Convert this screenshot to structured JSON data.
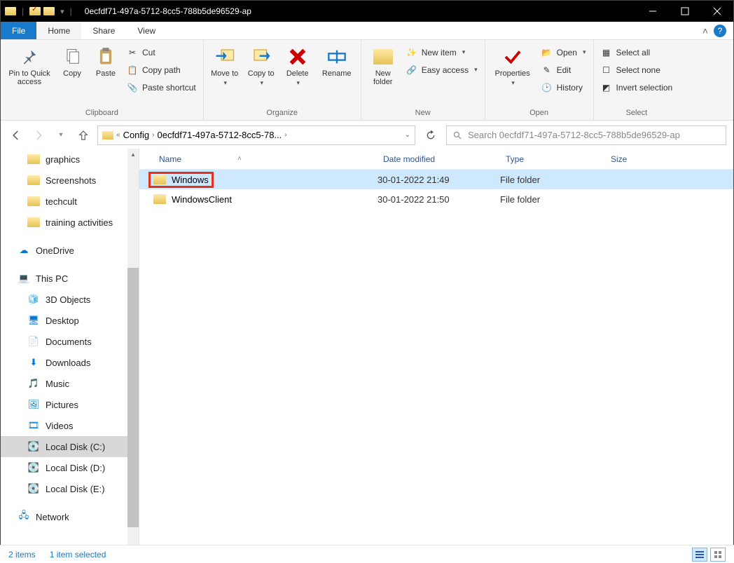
{
  "title": "0ecfdf71-497a-5712-8cc5-788b5de96529-ap",
  "tabs": {
    "file": "File",
    "home": "Home",
    "share": "Share",
    "view": "View"
  },
  "ribbon": {
    "clipboard": {
      "label": "Clipboard",
      "pin": "Pin to Quick access",
      "copy": "Copy",
      "paste": "Paste",
      "cut": "Cut",
      "copypath": "Copy path",
      "pasteshortcut": "Paste shortcut"
    },
    "organize": {
      "label": "Organize",
      "moveto": "Move to",
      "copyto": "Copy to",
      "delete": "Delete",
      "rename": "Rename"
    },
    "new": {
      "label": "New",
      "newfolder": "New folder",
      "newitem": "New item",
      "easyaccess": "Easy access"
    },
    "open": {
      "label": "Open",
      "properties": "Properties",
      "open": "Open",
      "edit": "Edit",
      "history": "History"
    },
    "select": {
      "label": "Select",
      "all": "Select all",
      "none": "Select none",
      "invert": "Invert selection"
    }
  },
  "breadcrumb": {
    "seg1": "Config",
    "seg2": "0ecfdf71-497a-5712-8cc5-78..."
  },
  "search_placeholder": "Search 0ecfdf71-497a-5712-8cc5-788b5de96529-ap",
  "tree": {
    "graphics": "graphics",
    "screenshots": "Screenshots",
    "techcult": "techcult",
    "training": "training activities",
    "onedrive": "OneDrive",
    "thispc": "This PC",
    "objects3d": "3D Objects",
    "desktop": "Desktop",
    "documents": "Documents",
    "downloads": "Downloads",
    "music": "Music",
    "pictures": "Pictures",
    "videos": "Videos",
    "diskc": "Local Disk (C:)",
    "diskd": "Local Disk (D:)",
    "diske": "Local Disk (E:)",
    "network": "Network"
  },
  "columns": {
    "name": "Name",
    "date": "Date modified",
    "type": "Type",
    "size": "Size"
  },
  "rows": [
    {
      "name": "Windows",
      "date": "30-01-2022 21:49",
      "type": "File folder"
    },
    {
      "name": "WindowsClient",
      "date": "30-01-2022 21:50",
      "type": "File folder"
    }
  ],
  "status": {
    "items": "2 items",
    "selected": "1 item selected"
  }
}
